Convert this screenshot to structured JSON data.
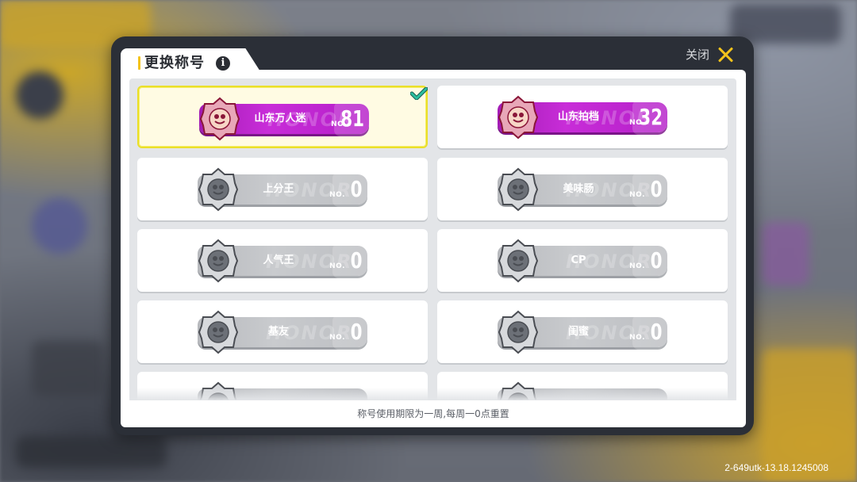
{
  "dialog": {
    "title": "更换称号",
    "close_label": "关闭",
    "footer_note": "称号使用期限为一周,每周一0点重置"
  },
  "build_version": "2-649utk-13.18.1245008",
  "titles": [
    {
      "name": "山东万人迷",
      "no_label": "NO.",
      "count": "81",
      "style": "purple",
      "selected": true,
      "emblem": "cake-emblem-icon"
    },
    {
      "name": "山东拍档",
      "no_label": "NO.",
      "count": "32",
      "style": "purple",
      "selected": false,
      "emblem": "partner-emblem-icon"
    },
    {
      "name": "上分王",
      "no_label": "NO.",
      "count": "0",
      "style": "gray",
      "selected": false,
      "emblem": "star-emblem-icon"
    },
    {
      "name": "美味肠",
      "no_label": "NO.",
      "count": "0",
      "style": "gray",
      "selected": false,
      "emblem": "smile-emblem-icon"
    },
    {
      "name": "人气王",
      "no_label": "NO.",
      "count": "0",
      "style": "gray",
      "selected": false,
      "emblem": "flame-emblem-icon"
    },
    {
      "name": "CP",
      "no_label": "NO.",
      "count": "0",
      "style": "gray",
      "selected": false,
      "emblem": "heart-emblem-icon"
    },
    {
      "name": "基友",
      "no_label": "NO.",
      "count": "0",
      "style": "gray",
      "selected": false,
      "emblem": "pair-emblem-icon"
    },
    {
      "name": "闺蜜",
      "no_label": "NO.",
      "count": "0",
      "style": "gray",
      "selected": false,
      "emblem": "girls-emblem-icon"
    }
  ],
  "badge_watermark": "HONOR",
  "colors": {
    "accent_yellow": "#f3c31b",
    "badge_purple": "#c82dd8",
    "badge_gray": "#c9cbce",
    "selected_border": "#eadf2a",
    "check_teal": "#2bbf9f"
  }
}
